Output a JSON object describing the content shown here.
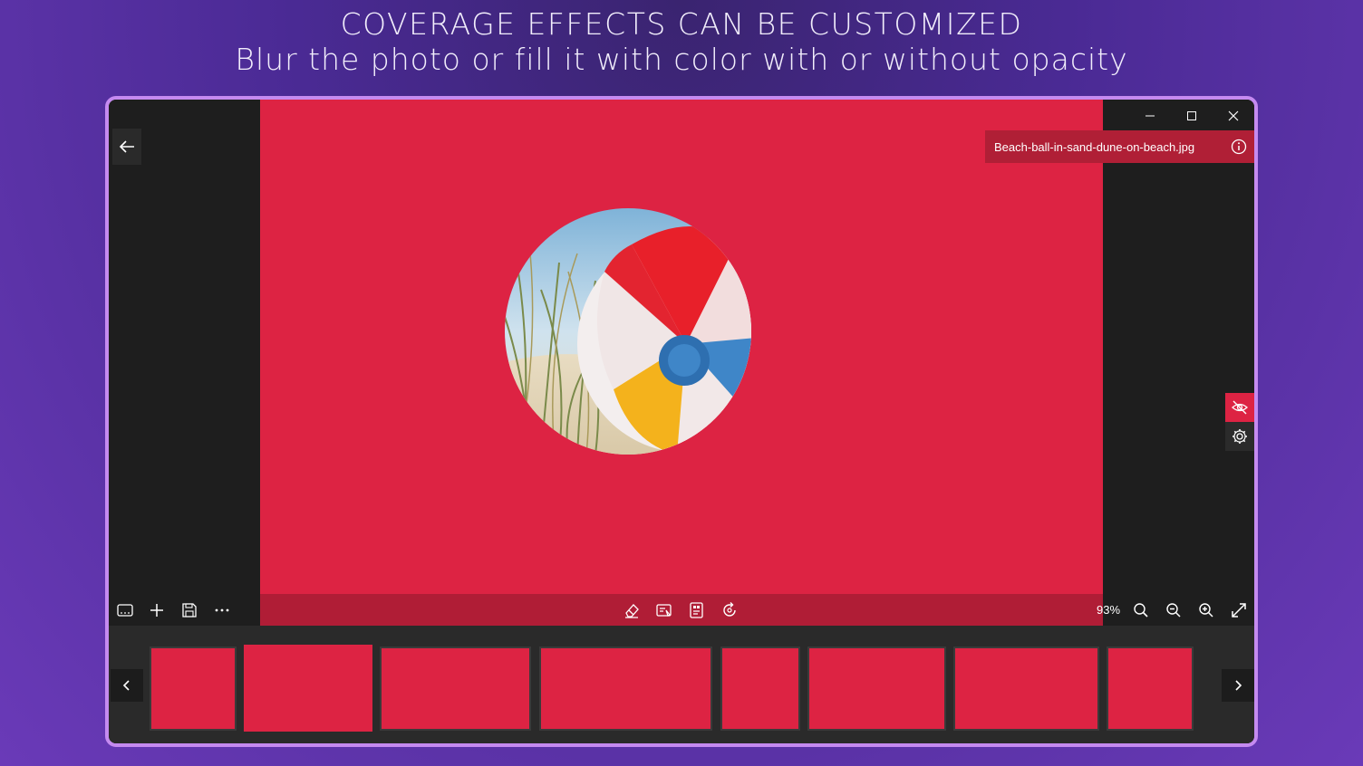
{
  "headline": {
    "line1": "COVERAGE EFFECTS CAN BE CUSTOMIZED",
    "line2": "Blur the photo or fill it with color with or without opacity"
  },
  "window_controls": [
    "minimize-icon",
    "maximize-icon",
    "close-icon"
  ],
  "file": {
    "name": "Beach-ball-in-sand-dune-on-beach.jpg"
  },
  "colors": {
    "fill": "#dd2343",
    "toolbar": "#b01d36",
    "border": "#c58af0"
  },
  "toolbar": {
    "zoom": "93%"
  },
  "side_tools": [
    "hide-eye-icon",
    "settings-gear-icon"
  ],
  "filmstrip": {
    "thumbnail_count": 8
  }
}
